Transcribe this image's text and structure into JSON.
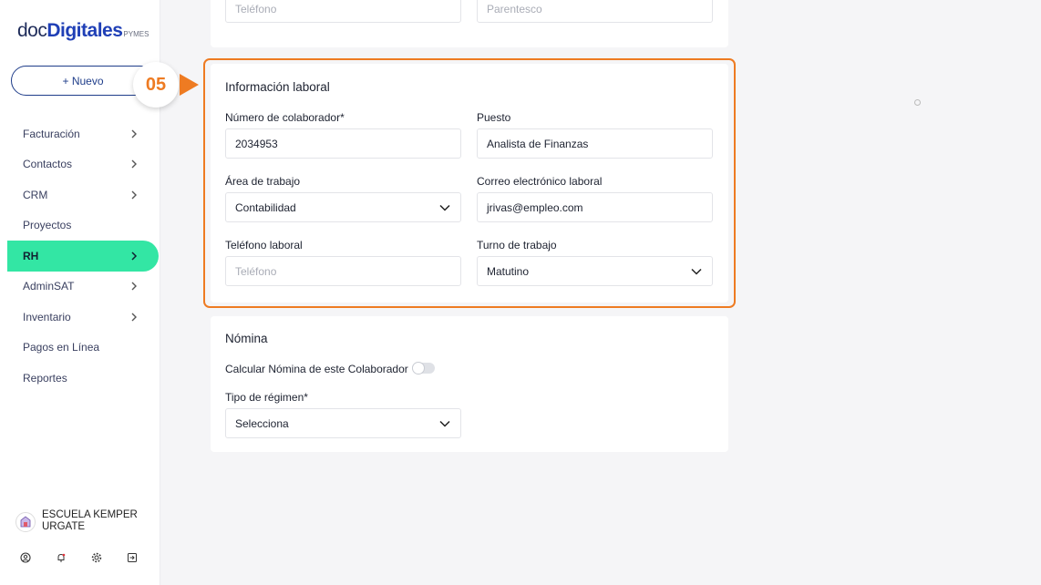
{
  "logo": {
    "doc": "doc",
    "digitales": "Digitales",
    "pymes": "PYMES"
  },
  "nuevo_label": "+ Nuevo",
  "nav": [
    {
      "label": "Facturación",
      "chevron": true
    },
    {
      "label": "Contactos",
      "chevron": true
    },
    {
      "label": "CRM",
      "chevron": true
    },
    {
      "label": "Proyectos",
      "chevron": false
    },
    {
      "label": "RH",
      "chevron": true,
      "active": true
    },
    {
      "label": "AdminSAT",
      "chevron": true
    },
    {
      "label": "Inventario",
      "chevron": true
    },
    {
      "label": "Pagos en Línea",
      "chevron": false
    },
    {
      "label": "Reportes",
      "chevron": false
    }
  ],
  "user": {
    "name": "ESCUELA KEMPER URGATE"
  },
  "bottom_icons": [
    "user-icon",
    "bell-icon",
    "gear-icon",
    "logout-icon"
  ],
  "top_card": {
    "phone_placeholder": "Teléfono",
    "relationship_placeholder": "Parentesco"
  },
  "step_badge": "05",
  "accent_color": "#ee7b22",
  "active_nav_color": "#33e6a4",
  "laboral": {
    "title": "Información laboral",
    "numero_label": "Número de colaborador*",
    "numero_value": "2034953",
    "puesto_label": "Puesto",
    "puesto_value": "Analista de Finanzas",
    "area_label": "Área de trabajo",
    "area_value": "Contabilidad",
    "correo_label": "Correo electrónico laboral",
    "correo_value": "jrivas@empleo.com",
    "telefono_label": "Teléfono laboral",
    "telefono_placeholder": "Teléfono",
    "turno_label": "Turno de trabajo",
    "turno_value": "Matutino"
  },
  "nomina": {
    "title": "Nómina",
    "calcular_label": "Calcular Nómina de este Colaborador",
    "calcular_on": false,
    "regimen_label": "Tipo de régimen*",
    "regimen_value": "Selecciona"
  }
}
